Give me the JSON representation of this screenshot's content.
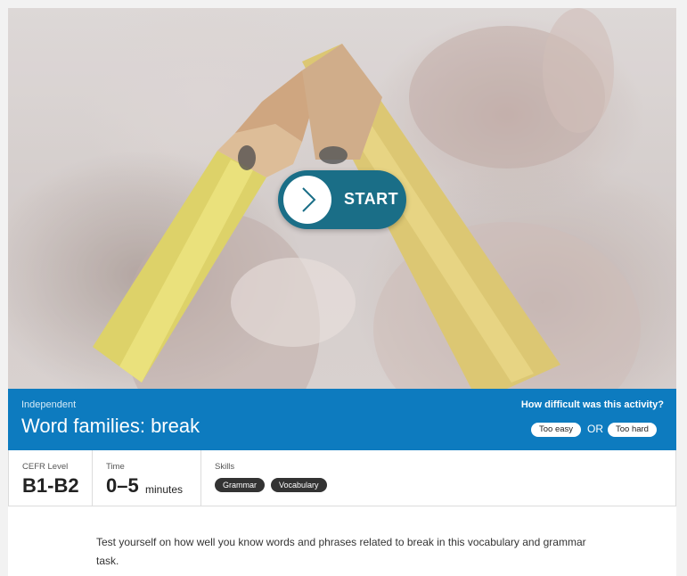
{
  "start": {
    "label": "START"
  },
  "activity": {
    "level": "Independent",
    "title": "Word families: break",
    "difficulty_question": "How difficult was this activity?",
    "too_easy": "Too easy",
    "or": "OR",
    "too_hard": "Too hard"
  },
  "meta": {
    "cefr_label": "CEFR Level",
    "cefr_value": "B1-B2",
    "time_label": "Time",
    "time_value": "0–5",
    "time_unit": "minutes",
    "skills_label": "Skills",
    "skills": [
      "Grammar",
      "Vocabulary"
    ]
  },
  "description": "Test yourself on how well you know words and phrases related to break in this vocabulary and grammar task.",
  "colors": {
    "band": "#0d7bbf",
    "start_button": "#1a6e87",
    "skill_pill": "#333333"
  },
  "icons": {
    "start": "chevron-right-icon"
  }
}
